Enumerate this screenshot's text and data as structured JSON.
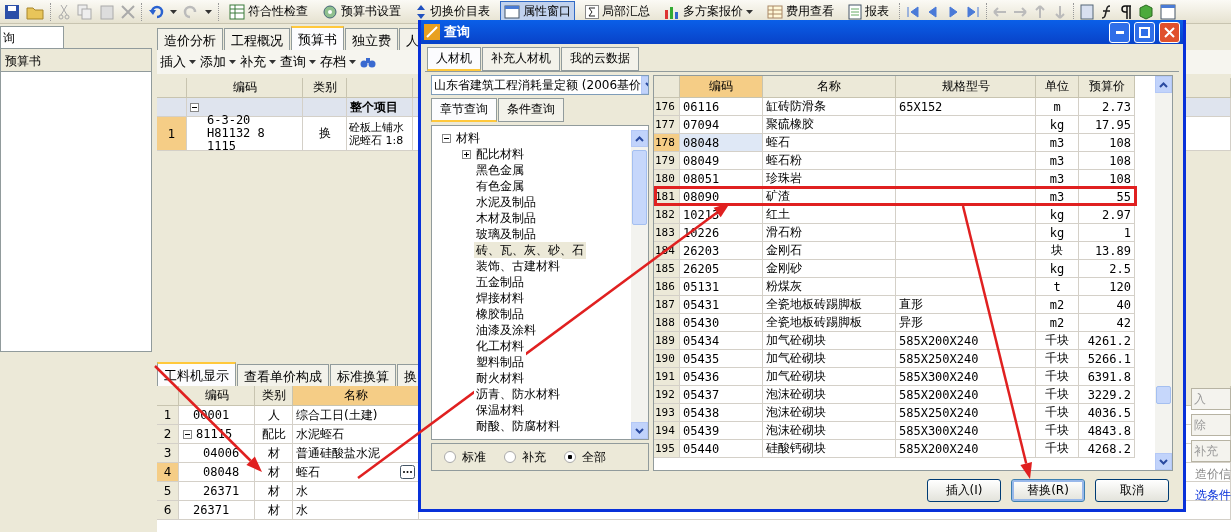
{
  "toolbar": {
    "items": [
      {
        "label": "符合性检查",
        "selected": false
      },
      {
        "label": "预算书设置",
        "selected": false
      },
      {
        "label": "切换价目表",
        "selected": false
      },
      {
        "label": "属性窗口",
        "selected": true
      },
      {
        "label": "局部汇总",
        "selected": false
      },
      {
        "label": "多方案报价",
        "selected": false,
        "dropdown": true
      },
      {
        "label": "费用查看",
        "selected": false
      },
      {
        "label": "报表",
        "selected": false
      }
    ]
  },
  "left_panel": {
    "tab": "询",
    "header": "预算书"
  },
  "main_tabs": [
    {
      "label": "造价分析",
      "selected": false
    },
    {
      "label": "工程概况",
      "selected": false
    },
    {
      "label": "预算书",
      "selected": true
    },
    {
      "label": "独立费",
      "selected": false
    },
    {
      "label": "人",
      "selected": false
    }
  ],
  "main_toolbar": [
    "插入",
    "添加",
    "补充",
    "查询",
    "存档"
  ],
  "budget_grid": {
    "columns": [
      "编码",
      "类别"
    ],
    "group": {
      "label": "整个项目",
      "expanded": true
    },
    "rows": [
      {
        "index": "1",
        "code": "6-3-20 H81132 8 1115",
        "type": "换",
        "name": "砼板上铺水泥蛭石 1:8",
        "selected": true
      }
    ]
  },
  "lower_tabs": [
    {
      "label": "工料机显示",
      "selected": true
    },
    {
      "label": "查看单价构成",
      "selected": false
    },
    {
      "label": "标准换算",
      "selected": false
    },
    {
      "label": "换",
      "selected": false
    }
  ],
  "material_grid": {
    "columns": [
      "编码",
      "类别",
      "名称"
    ],
    "rows": [
      {
        "index": "1",
        "code": "00001",
        "type": "人",
        "name": "综合工日(土建)",
        "selected": false
      },
      {
        "index": "2",
        "code": "81115",
        "type": "配比",
        "name": "水泥蛭石",
        "expanded": true,
        "selected": false,
        "children": [
          {
            "index": "3",
            "code": "04006",
            "type": "材",
            "name": "普通硅酸盐水泥",
            "selected": false
          },
          {
            "index": "4",
            "code": "08048",
            "type": "材",
            "name": "蛭石",
            "selected": true
          },
          {
            "index": "5",
            "code": "26371",
            "type": "材",
            "name": "水",
            "selected": false
          }
        ]
      },
      {
        "index": "6",
        "code": "26371",
        "type": "材",
        "name": "水",
        "selected": false
      }
    ]
  },
  "side_panel": {
    "buttons": [
      "入",
      "除",
      "补充"
    ],
    "link": "造价信",
    "footer": "选条件"
  },
  "dialog": {
    "title": "查询",
    "tabs": [
      {
        "label": "人材机",
        "selected": true
      },
      {
        "label": "补充人材机",
        "selected": false
      },
      {
        "label": "我的云数据",
        "selected": false
      }
    ],
    "library": "山东省建筑工程消耗量定额 (2006基价",
    "search_tabs": [
      {
        "label": "章节查询",
        "selected": true
      },
      {
        "label": "条件查询",
        "selected": false
      }
    ],
    "tree": [
      {
        "label": "材料",
        "expanded": true,
        "selected": false,
        "children": [
          {
            "label": "配比材料",
            "expanded": false,
            "selected": false
          },
          {
            "label": "黑色金属",
            "selected": false
          },
          {
            "label": "有色金属",
            "selected": false
          },
          {
            "label": "水泥及制品",
            "selected": false
          },
          {
            "label": "木材及制品",
            "selected": false
          },
          {
            "label": "玻璃及制品",
            "selected": false
          },
          {
            "label": "砖、瓦、灰、砂、石",
            "selected": true
          },
          {
            "label": "装饰、古建材料",
            "selected": false
          },
          {
            "label": "五金制品",
            "selected": false
          },
          {
            "label": "焊接材料",
            "selected": false
          },
          {
            "label": "橡胶制品",
            "selected": false
          },
          {
            "label": "油漆及涂料",
            "selected": false
          },
          {
            "label": "化工材料",
            "selected": false
          },
          {
            "label": "塑料制品",
            "selected": false
          },
          {
            "label": "耐火材料",
            "selected": false
          },
          {
            "label": "沥青、防水材料",
            "selected": false
          },
          {
            "label": "保温材料",
            "selected": false
          },
          {
            "label": "耐酸、防腐材料",
            "selected": false
          }
        ]
      }
    ],
    "filters": [
      {
        "label": "标准",
        "selected": false
      },
      {
        "label": "补充",
        "selected": false
      },
      {
        "label": "全部",
        "selected": true
      }
    ],
    "table": {
      "columns": [
        "编码",
        "名称",
        "规格型号",
        "单位",
        "预算价"
      ],
      "rows": [
        {
          "index": "176",
          "code": "06116",
          "name": "缸砖防滑条",
          "spec": "65X152",
          "unit": "m",
          "price": "2.73",
          "selected": false
        },
        {
          "index": "177",
          "code": "07094",
          "name": "聚硫橡胶",
          "unit": "kg",
          "price": "17.95",
          "selected": false
        },
        {
          "index": "178",
          "code": "08048",
          "name": "蛭石",
          "unit": "m3",
          "price": "108",
          "selected": true
        },
        {
          "index": "179",
          "code": "08049",
          "name": "蛭石粉",
          "unit": "m3",
          "price": "108",
          "selected": false
        },
        {
          "index": "180",
          "code": "08051",
          "name": "珍珠岩",
          "unit": "m3",
          "price": "108",
          "selected": false
        },
        {
          "index": "181",
          "code": "08090",
          "name": "矿渣",
          "unit": "m3",
          "price": "55",
          "selected": false,
          "highlighted": true
        },
        {
          "index": "182",
          "code": "10213",
          "name": "红土",
          "unit": "kg",
          "price": "2.97",
          "selected": false
        },
        {
          "index": "183",
          "code": "10226",
          "name": "滑石粉",
          "unit": "kg",
          "price": "1",
          "selected": false
        },
        {
          "index": "184",
          "code": "26203",
          "name": "金刚石",
          "unit": "块",
          "price": "13.89",
          "selected": false
        },
        {
          "index": "185",
          "code": "26205",
          "name": "金刚砂",
          "unit": "kg",
          "price": "2.5",
          "selected": false
        },
        {
          "index": "186",
          "code": "05131",
          "name": "粉煤灰",
          "unit": "t",
          "price": "120",
          "selected": false
        },
        {
          "index": "187",
          "code": "05431",
          "name": "全瓷地板砖踢脚板",
          "spec": "直形",
          "unit": "m2",
          "price": "40",
          "selected": false
        },
        {
          "index": "188",
          "code": "05430",
          "name": "全瓷地板砖踢脚板",
          "spec": "异形",
          "unit": "m2",
          "price": "42",
          "selected": false
        },
        {
          "index": "189",
          "code": "05434",
          "name": "加气砼砌块",
          "spec": "585X200X240",
          "unit": "千块",
          "price": "4261.2",
          "selected": false
        },
        {
          "index": "190",
          "code": "05435",
          "name": "加气砼砌块",
          "spec": "585X250X240",
          "unit": "千块",
          "price": "5266.1",
          "selected": false
        },
        {
          "index": "191",
          "code": "05436",
          "name": "加气砼砌块",
          "spec": "585X300X240",
          "unit": "千块",
          "price": "6391.8",
          "selected": false
        },
        {
          "index": "192",
          "code": "05437",
          "name": "泡沫砼砌块",
          "spec": "585X200X240",
          "unit": "千块",
          "price": "3229.2",
          "selected": false
        },
        {
          "index": "193",
          "code": "05438",
          "name": "泡沫砼砌块",
          "spec": "585X250X240",
          "unit": "千块",
          "price": "4036.5",
          "selected": false
        },
        {
          "index": "194",
          "code": "05439",
          "name": "泡沫砼砌块",
          "spec": "585X300X240",
          "unit": "千块",
          "price": "4843.8",
          "selected": false
        },
        {
          "index": "195",
          "code": "05440",
          "name": "硅酸钙砌块",
          "spec": "585X200X240",
          "unit": "千块",
          "price": "4268.2",
          "selected": false
        }
      ]
    },
    "buttons": [
      {
        "label": "插入(I)",
        "focused": false
      },
      {
        "label": "替换(R)",
        "focused": true
      },
      {
        "label": "取消",
        "focused": false
      }
    ]
  },
  "annotations": [
    {
      "kind": "arrow"
    },
    {
      "kind": "arrow"
    },
    {
      "kind": "arrow"
    }
  ]
}
